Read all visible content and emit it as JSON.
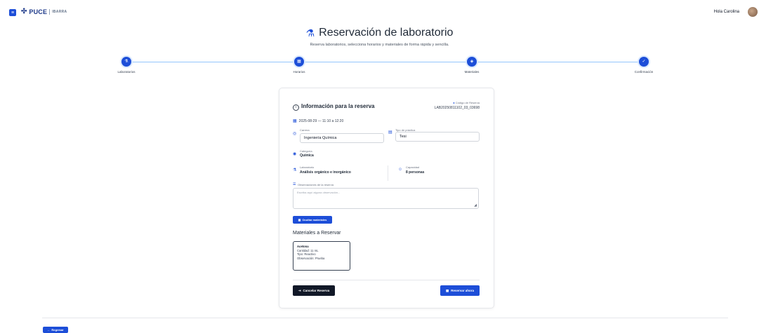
{
  "header": {
    "menu_icon": "menu-icon",
    "brand": "PUCE",
    "brand_mark": "✣",
    "campus": "IBARRA",
    "greeting": "Hola Carolina"
  },
  "page": {
    "title": "Reservación de laboratorio",
    "title_icon": "microscope-icon",
    "subtitle": "Reserva laboratorios, selecciona horarios y materiales de forma rápida y sencilla."
  },
  "steps": [
    {
      "label": "Laboratorios",
      "icon": "flask-icon"
    },
    {
      "label": "Horarios",
      "icon": "calendar-icon"
    },
    {
      "label": "Materiales",
      "icon": "box-icon"
    },
    {
      "label": "Confirmación",
      "icon": "check-icon"
    }
  ],
  "reservation": {
    "title": "Información para la reserva",
    "code_label": "Código de Reserva",
    "code_value": "LAB20250811102_03_03698",
    "datetime": "2025-08-29 — 11:10 a 12:20",
    "career_label": "Carrera",
    "career_value": "Ingeniería Química",
    "type_label": "Tipo de práctica",
    "type_value": "Tesi",
    "category_label": "Categoría",
    "category_value": "Química",
    "lab_label": "Laboratorio",
    "lab_value": "Análisis orgánico e inorgánico",
    "capacity_label": "Capacidad",
    "capacity_value": "8 personas",
    "notes_label": "Observaciones de la reserva",
    "notes_placeholder": "Escriba aquí alguna observación...",
    "toggle_materials": "Ocultar materiales",
    "materials_title": "Materiales a Reservar",
    "materials": [
      {
        "name": "Acetona",
        "quantity": "Cantidad: 11 mL",
        "type": "Tipo: Reactivo",
        "note": "Observación: Prueba"
      }
    ],
    "cancel_label": "Cancelar Reserva",
    "reserve_label": "Reservar ahora"
  },
  "footer": {
    "back_label": "Regresar"
  },
  "colors": {
    "accent": "#1d4ed8",
    "dark_button": "#111827"
  }
}
